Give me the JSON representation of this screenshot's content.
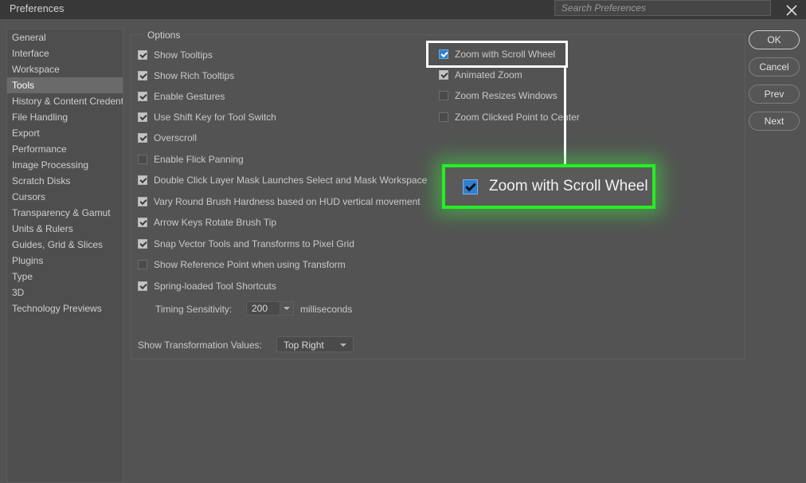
{
  "window": {
    "title": "Preferences",
    "close_icon": "close-icon"
  },
  "search": {
    "placeholder": "Search Preferences"
  },
  "sidebar": {
    "items": [
      {
        "label": "General",
        "selected": false
      },
      {
        "label": "Interface",
        "selected": false
      },
      {
        "label": "Workspace",
        "selected": false
      },
      {
        "label": "Tools",
        "selected": true
      },
      {
        "label": "History & Content Credentials",
        "selected": false
      },
      {
        "label": "File Handling",
        "selected": false
      },
      {
        "label": "Export",
        "selected": false
      },
      {
        "label": "Performance",
        "selected": false
      },
      {
        "label": "Image Processing",
        "selected": false
      },
      {
        "label": "Scratch Disks",
        "selected": false
      },
      {
        "label": "Cursors",
        "selected": false
      },
      {
        "label": "Transparency & Gamut",
        "selected": false
      },
      {
        "label": "Units & Rulers",
        "selected": false
      },
      {
        "label": "Guides, Grid & Slices",
        "selected": false
      },
      {
        "label": "Plugins",
        "selected": false
      },
      {
        "label": "Type",
        "selected": false
      },
      {
        "label": "3D",
        "selected": false
      },
      {
        "label": "Technology Previews",
        "selected": false
      }
    ]
  },
  "options": {
    "group_label": "Options",
    "left_column": [
      {
        "label": "Show Tooltips",
        "checked": true
      },
      {
        "label": "Show Rich Tooltips",
        "checked": true
      },
      {
        "label": "Enable Gestures",
        "checked": true
      },
      {
        "label": "Use Shift Key for Tool Switch",
        "checked": true
      },
      {
        "label": "Overscroll",
        "checked": true
      },
      {
        "label": "Enable Flick Panning",
        "checked": false
      },
      {
        "label": "Double Click Layer Mask Launches Select and Mask Workspace",
        "checked": true
      },
      {
        "label": "Vary Round Brush Hardness based on HUD vertical movement",
        "checked": true
      },
      {
        "label": "Arrow Keys Rotate Brush Tip",
        "checked": true
      },
      {
        "label": "Snap Vector Tools and Transforms to Pixel Grid",
        "checked": true
      },
      {
        "label": "Show Reference Point when using Transform",
        "checked": false
      },
      {
        "label": "Spring-loaded Tool Shortcuts",
        "checked": true
      }
    ],
    "right_column": [
      {
        "label": "Zoom with Scroll Wheel",
        "checked": true,
        "highlighted": true
      },
      {
        "label": "Animated Zoom",
        "checked": true,
        "highlighted": false
      },
      {
        "label": "Zoom Resizes Windows",
        "checked": false,
        "highlighted": false
      },
      {
        "label": "Zoom Clicked Point to Center",
        "checked": false,
        "highlighted": false
      }
    ],
    "timing": {
      "label": "Timing Sensitivity:",
      "value": "200",
      "unit": "milliseconds"
    },
    "transformation": {
      "label": "Show Transformation Values:",
      "value": "Top Right"
    }
  },
  "buttons": [
    {
      "label": "OK",
      "primary": true
    },
    {
      "label": "Cancel",
      "primary": false
    },
    {
      "label": "Prev",
      "primary": false
    },
    {
      "label": "Next",
      "primary": false
    }
  ],
  "callout": {
    "label": "Zoom with Scroll Wheel",
    "checked": true,
    "border_color": "#25ef25",
    "glow_color": "#3cff3c"
  },
  "annotation": {
    "outline_color": "#ffffff"
  }
}
